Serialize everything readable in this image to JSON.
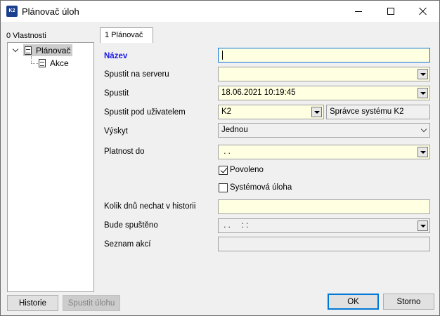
{
  "window": {
    "title": "Plánovač úloh",
    "app_icon": "k2-app-icon"
  },
  "left": {
    "label": "0 Vlastnosti",
    "tree": [
      {
        "label": "Plánovač",
        "icon": "document-icon",
        "selected": true,
        "expanded": true
      },
      {
        "label": "Akce",
        "icon": "document-icon",
        "selected": false
      }
    ]
  },
  "tab": {
    "label": "1 Plánovač"
  },
  "form": {
    "nazev": {
      "label": "Název",
      "value": ""
    },
    "spustit_na_serveru": {
      "label": "Spustit na serveru",
      "value": ""
    },
    "spustit": {
      "label": "Spustit",
      "value": "18.06.2021 10:19:45"
    },
    "spustit_pod_uzivatelem": {
      "label": "Spustit pod uživatelem",
      "value": "K2",
      "description": "Správce systému K2"
    },
    "vyskyt": {
      "label": "Výskyt",
      "value": "Jednou"
    },
    "platnost_do": {
      "label": "Platnost do",
      "value": " . ."
    },
    "povoleno": {
      "label": "Povoleno",
      "checked": true
    },
    "systemova_uloha": {
      "label": "Systémová úloha",
      "checked": false
    },
    "kolik_dnu": {
      "label": "Kolik dnů nechat v historii",
      "value": ""
    },
    "bude_spusteno": {
      "label": "Bude spuštěno",
      "value": " . .     : :"
    },
    "seznam_akci": {
      "label": "Seznam akcí",
      "value": ""
    }
  },
  "buttons": {
    "historie": "Historie",
    "spustit_ulohu": "Spustit úlohu",
    "ok": "OK",
    "storno": "Storno"
  },
  "colors": {
    "field_bg": "#ffffe1",
    "required_label": "#1a1ae6",
    "focus_border": "#0a74d9"
  }
}
